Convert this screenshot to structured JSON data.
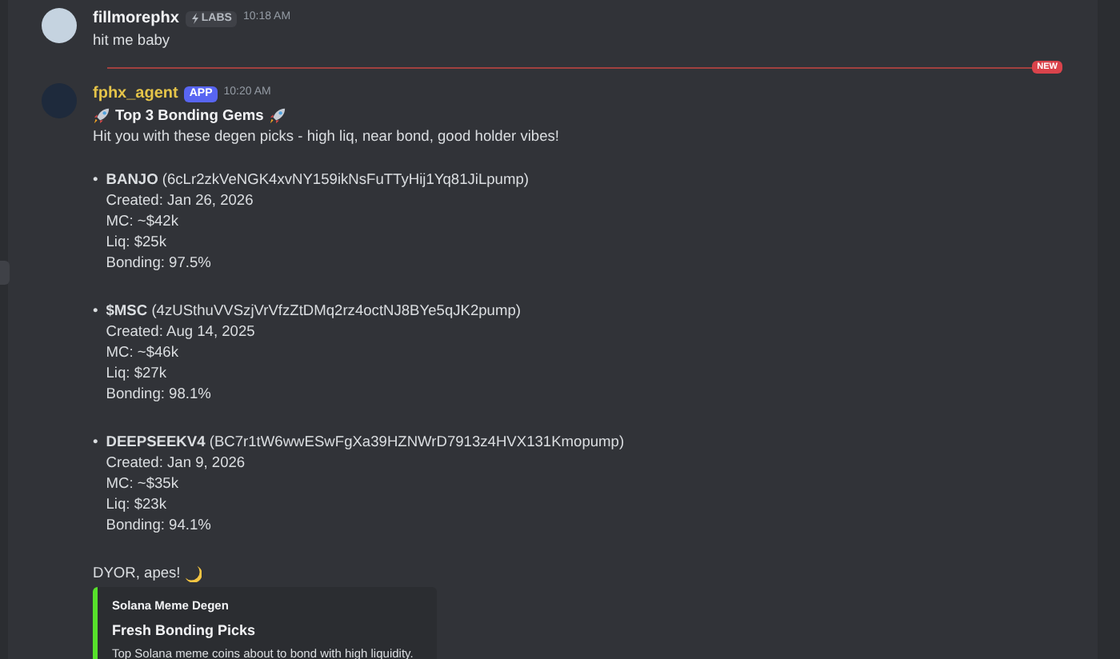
{
  "messages": [
    {
      "author": "fillmorephx",
      "color": "#f2f3f5",
      "tag": {
        "kind": "labs",
        "text": "LABS"
      },
      "time": "10:18 AM",
      "body": [
        {
          "kind": "text",
          "text": "hit me baby"
        }
      ]
    },
    {
      "author": "fphx_agent",
      "color": "#e5c449",
      "tag": {
        "kind": "app",
        "text": "APP"
      },
      "time": "10:20 AM",
      "new_divider": "NEW",
      "body": [
        {
          "kind": "heading",
          "text": "Top 3 Bonding Gems"
        },
        {
          "kind": "text",
          "text": "Hit you with these degen picks - high liq, near bond, good holder vibes!"
        },
        {
          "kind": "picks",
          "bullet": "•",
          "items": [
            {
              "name": "BANJO",
              "address": "(6cLr2zkVeNGK4xvNY159ikNsFuTTyHij1Yq81JiLpump)",
              "lines": [
                "Created: Jan 26, 2026",
                "MC: ~$42k",
                "Liq: $25k",
                "Bonding: 97.5%"
              ]
            },
            {
              "name": "$MSC",
              "address": "(4zUSthuVVSzjVrVfzZtDMq2rz4octNJ8BYe5qJK2pump)",
              "lines": [
                "Created: Aug 14, 2025",
                "MC: ~$46k",
                "Liq: $27k",
                "Bonding: 98.1%"
              ]
            },
            {
              "name": "DEEPSEEKV4",
              "address": "(BC7r1tW6wwESwFgXa39HZNWrD7913z4HVX131Kmopump)",
              "lines": [
                "Created: Jan 9, 2026",
                "MC: ~$35k",
                "Liq: $23k",
                "Bonding: 94.1%"
              ]
            }
          ]
        },
        {
          "kind": "closing",
          "text": "DYOR, apes!"
        },
        {
          "kind": "embed",
          "color": "#57e12b",
          "provider": "Solana Meme Degen",
          "title": "Fresh Bonding Picks",
          "description": "Top Solana meme coins about to bond with high liquidity."
        }
      ]
    }
  ]
}
